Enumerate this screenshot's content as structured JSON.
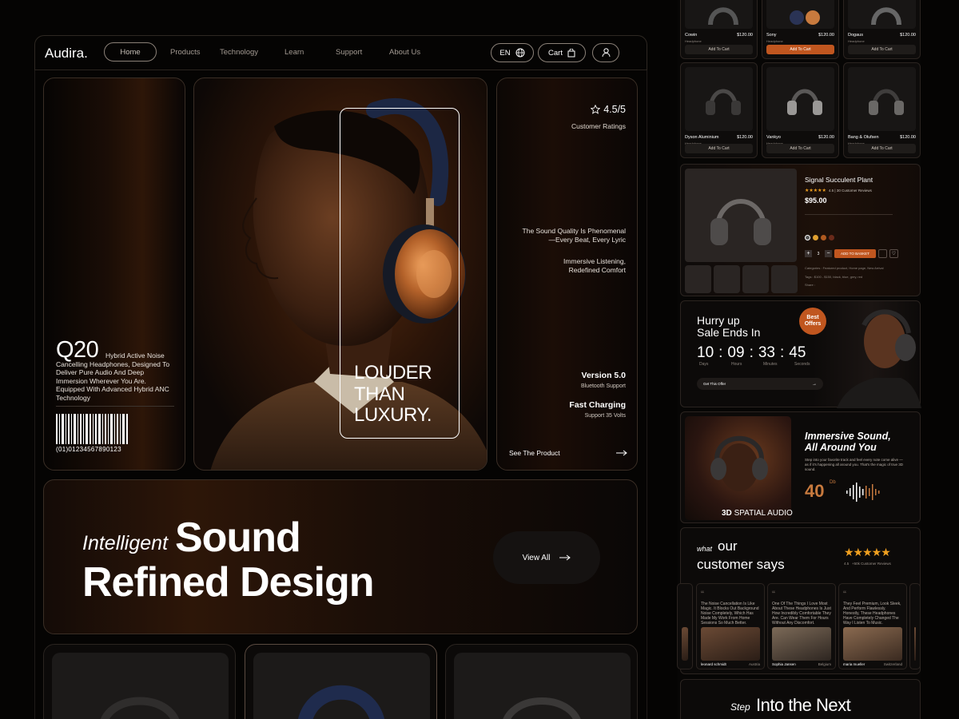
{
  "brand": "Audira.",
  "nav": {
    "items": [
      "Home",
      "Products",
      "Technology",
      "Learn",
      "Support",
      "About Us"
    ],
    "lang": "EN",
    "cart": "Cart"
  },
  "hero": {
    "model": "Q20",
    "model_desc": "Hybrid Active Noise Cancelling Headphones, Designed To Deliver Pure Audio And Deep Immersion Wherever You Are. Equipped With Advanced Hybrid ANC Technology",
    "barcode_number": "(01)01234567890123",
    "tagline": [
      "LOUDER",
      "THAN",
      "LUXURY."
    ],
    "rating": "4.5/5",
    "rating_label": "Customer Ratings",
    "quote1": "The Sound Quality Is Phenomenal —Every Beat, Every Lyric",
    "quote2": "Immersive Listening, Redefined Comfort",
    "version": "Version 5.0",
    "version_sub": "Bluetooth Support",
    "charging": "Fast Charging",
    "charging_sub": "Support 35 Volts",
    "cta": "See The Product"
  },
  "banner": {
    "italic": "Intelligent",
    "line1": "Sound",
    "line2": "Refined Design",
    "button": "View All"
  },
  "side": {
    "products_row1": [
      {
        "name": "Cowin",
        "price": "$120.00",
        "sub": "Headphone",
        "cta": "Add To Cart"
      },
      {
        "name": "Sony",
        "price": "$120.00",
        "sub": "Headphone",
        "cta": "Add To Cart"
      },
      {
        "name": "Dogaus",
        "price": "$120.00",
        "sub": "Headphone",
        "cta": "Add To Cart"
      }
    ],
    "products_row2": [
      {
        "name": "Dyson Aluminium",
        "price": "$120.00",
        "sub": "Headphone",
        "cta": "Add To Cart"
      },
      {
        "name": "Vankyo",
        "price": "$120.00",
        "sub": "Headphone",
        "cta": "Add To Cart"
      },
      {
        "name": "Bang & Olufsen",
        "price": "$120.00",
        "sub": "Headphone",
        "cta": "Add To Cart"
      }
    ],
    "detail": {
      "title": "Signal Succulent Plant",
      "rating": "4.5 | 30 Customer Reviews",
      "price": "$95.00",
      "qty": "3",
      "add": "ADD TO BASKET",
      "categories": "Categories : Featured product, Home page, New Arrival",
      "tags": "Tags : $100 - $150, black, blue, grey, red",
      "share": "Share :"
    },
    "sale": {
      "title1": "Hurry up",
      "title2": "Sale Ends In",
      "badge": "Best Offers",
      "days": "10",
      "hours": "09",
      "minutes": "33",
      "seconds": "45",
      "l_days": "Days",
      "l_hours": "Hours",
      "l_minutes": "Minutes",
      "l_seconds": "Seconds",
      "cta": "Get This Offer"
    },
    "spatial": {
      "title1": "Immersive Sound,",
      "title2": "All Around You",
      "desc": "Step into your favorite track and feel every note come alive — as if it's happening all around you. That's the magic of true 3D sound.",
      "db": "40",
      "db_unit": "Db",
      "label_bold": "3D",
      "label": "SPATIAL AUDIO"
    },
    "reviews": {
      "italic": "what",
      "title1": "our",
      "title2": "customer says",
      "score": "4.5",
      "count": "+50k Customer Reviews",
      "items": [
        {
          "text": "The Noise Cancellation Is Like Magic. It Blocks Out Background Noise Completely, Which Has Made My Work From Home Sessions So Much Better.",
          "name": "leonard schmidt",
          "loc": "Austria"
        },
        {
          "text": "One Of The Things I Love Most About These Headphones Is Just How Incredibly Comfortable They Are. Can Wear Them For Hours Without Any Discomfort.",
          "name": "Sophia Jansen",
          "loc": "Belgium"
        },
        {
          "text": "They Feel Premium, Look Sleek, And Perform Flawlessly. Honestly, These Headphones Have Completely Changed The Way I Listen To Music.",
          "name": "maria mueller",
          "loc": "Switzerland"
        }
      ]
    },
    "next": {
      "italic": "Step",
      "title": "Into the Next"
    }
  },
  "colors": {
    "accent": "#c0561f",
    "copper": "#c87a3e",
    "bg": "#050403"
  }
}
